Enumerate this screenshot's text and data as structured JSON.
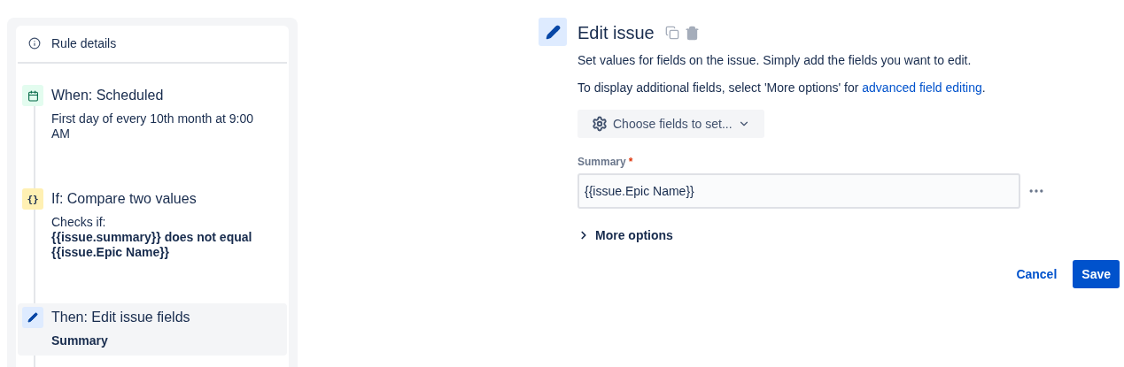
{
  "sidebar": {
    "header": "Rule details",
    "steps": [
      {
        "kind": "schedule",
        "title": "When: Scheduled",
        "selected": false,
        "details": [
          {
            "text": "First day of every 10th month at 9:00 AM",
            "bold": false
          }
        ]
      },
      {
        "kind": "condition",
        "title": "If: Compare two values",
        "icon_text": "{}",
        "selected": false,
        "details": [
          {
            "text": "Checks if:",
            "bold": false
          },
          {
            "text": "{{issue.summary}} does not equal {{issue.Epic Name}}",
            "bold": true
          }
        ]
      },
      {
        "kind": "action",
        "title": "Then: Edit issue fields",
        "selected": true,
        "details": [
          {
            "text": "Summary",
            "bold": true
          }
        ]
      }
    ]
  },
  "editor": {
    "title": "Edit issue",
    "description": "Set values for fields on the issue. Simply add the fields you want to edit.",
    "hint": "To display additional fields, select 'More options' for ",
    "hint_link": "advanced field editing",
    "hint_end": ".",
    "choose_button": "Choose fields to set...",
    "fields": [
      {
        "label": "Summary",
        "required": true,
        "required_mark": "*",
        "value": "{{issue.Epic Name}}"
      }
    ],
    "more_options": {
      "label": "More options",
      "expanded": false
    },
    "buttons": [
      {
        "kind": "subtle",
        "label": "Cancel"
      },
      {
        "kind": "primary",
        "label": "Save"
      }
    ]
  }
}
